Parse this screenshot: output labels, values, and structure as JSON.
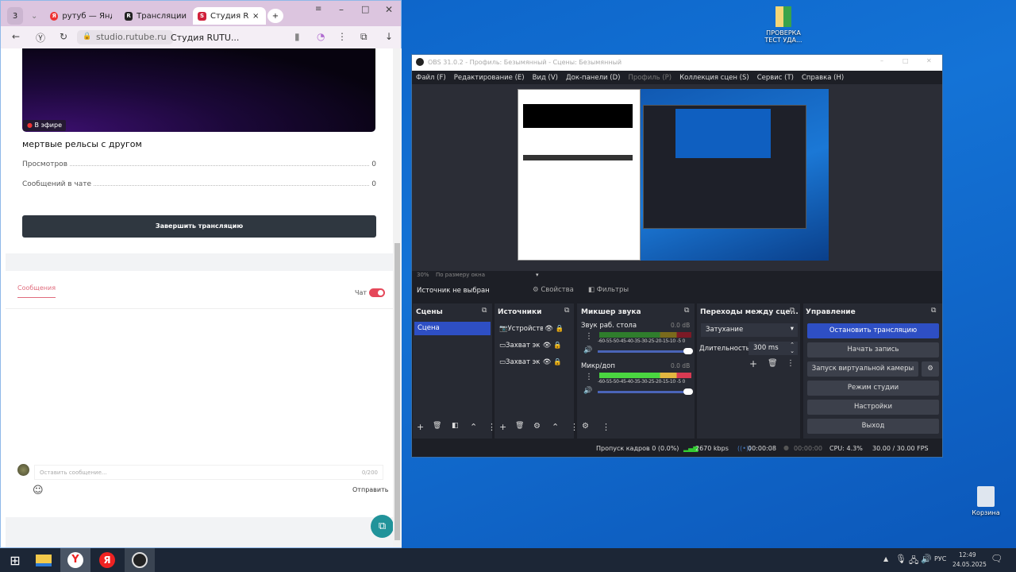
{
  "browser": {
    "tab_count": "3",
    "tabs": [
      {
        "label": "рутуб — Яндекс"
      },
      {
        "label": "Трансляции"
      },
      {
        "label": "Студия RUTUBE"
      }
    ],
    "url": "studio.rutube.ru",
    "page_title": "Студия RUTU...",
    "live_badge": "В эфире",
    "stream_title": "мертвые рельсы с другом",
    "stats": [
      {
        "label": "Просмотров",
        "value": "0"
      },
      {
        "label": "Сообщений в чате",
        "value": "0"
      }
    ],
    "end_button": "Завершить трансляцию",
    "messages_tab": "Сообщения",
    "chat_label": "Чат",
    "chat_enabled": true,
    "message_placeholder": "Оставить сообщение...",
    "message_counter": "0/200",
    "send_label": "Отправить"
  },
  "obs": {
    "title": "OBS 31.0.2 - Профиль: Безымянный - Сцены: Безымянный",
    "menu": [
      "Файл (F)",
      "Редактирование (E)",
      "Вид (V)",
      "Док-панели (D)",
      "Профиль (P)",
      "Коллекция сцен (S)",
      "Сервис (T)",
      "Справка (H)"
    ],
    "zoom": "30%",
    "zoom_mode": "По размеру окна",
    "no_source": "Источник не выбран",
    "properties": "Свойства",
    "filters": "Фильтры",
    "scenes": {
      "title": "Сцены",
      "items": [
        "Сцена"
      ]
    },
    "sources": {
      "title": "Источники",
      "items": [
        {
          "icon": "camera-icon",
          "label": "Устройство"
        },
        {
          "icon": "monitor-icon",
          "label": "Захват экрана"
        },
        {
          "icon": "monitor-icon",
          "label": "Захват экрана"
        }
      ]
    },
    "mixer": {
      "title": "Микшер звука",
      "channels": [
        {
          "name": "Звук раб. стола",
          "db": "0.0 dB",
          "volume": 1.0
        },
        {
          "name": "Микр/доп",
          "db": "0.0 dB",
          "volume": 1.0
        }
      ],
      "scale": "-60-55-50-45-40-35-30-25-20-15-10 -5  0"
    },
    "transitions": {
      "title": "Переходы между сце...",
      "selected": "Затухание",
      "duration_label": "Длительность",
      "duration": "300 ms"
    },
    "controls": {
      "title": "Управление",
      "buttons": [
        "Остановить трансляцию",
        "Начать запись",
        "Запуск виртуальной камеры",
        "Режим студии",
        "Настройки",
        "Выход"
      ]
    },
    "status": {
      "dropped": "Пропуск кадров 0 (0.0%)",
      "bitrate": "2670 kbps",
      "stream_time": "00:00:08",
      "rec_time": "00:00:00",
      "cpu": "CPU: 4.3%",
      "fps": "30.00 / 30.00 FPS"
    }
  },
  "desktop": {
    "folder": "ПРОВЕРКА ТЕСТ УДА...",
    "recycle": "Корзина"
  },
  "tray": {
    "lang": "РУС",
    "time": "12:49",
    "date": "24.05.2025"
  },
  "colors": {
    "obs_accent": "#2e4fc4",
    "rutube_red": "#e5485a",
    "browser_tabbar": "#dcc5df"
  }
}
